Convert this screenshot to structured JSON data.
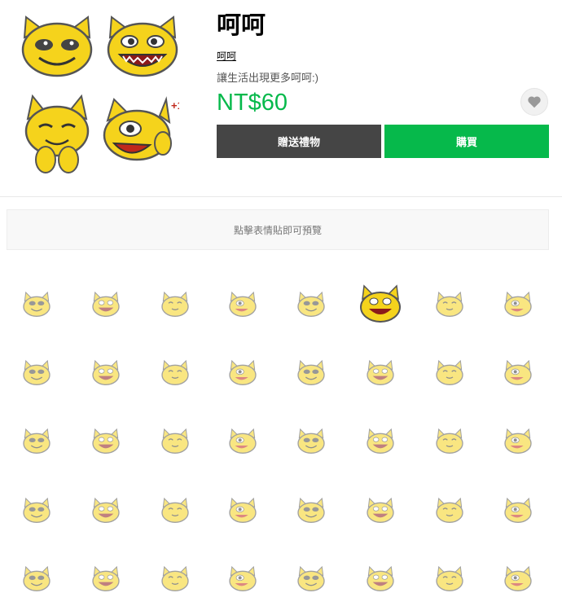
{
  "product": {
    "title": "呵呵",
    "author": "呵呵",
    "description": "讓生活出現更多呵呵:)",
    "price": "NT$60"
  },
  "buttons": {
    "gift_label": "贈送禮物",
    "buy_label": "購買"
  },
  "favorite": {
    "icon": "heart-icon"
  },
  "preview": {
    "hint": "點擊表情貼即可預覽"
  },
  "colors": {
    "accent": "#06b94b",
    "gift_button": "#454545",
    "sticker_yellow": "#f5d31c"
  },
  "stickers": {
    "rows": 5,
    "columns": 8,
    "highlighted_index": 5
  }
}
